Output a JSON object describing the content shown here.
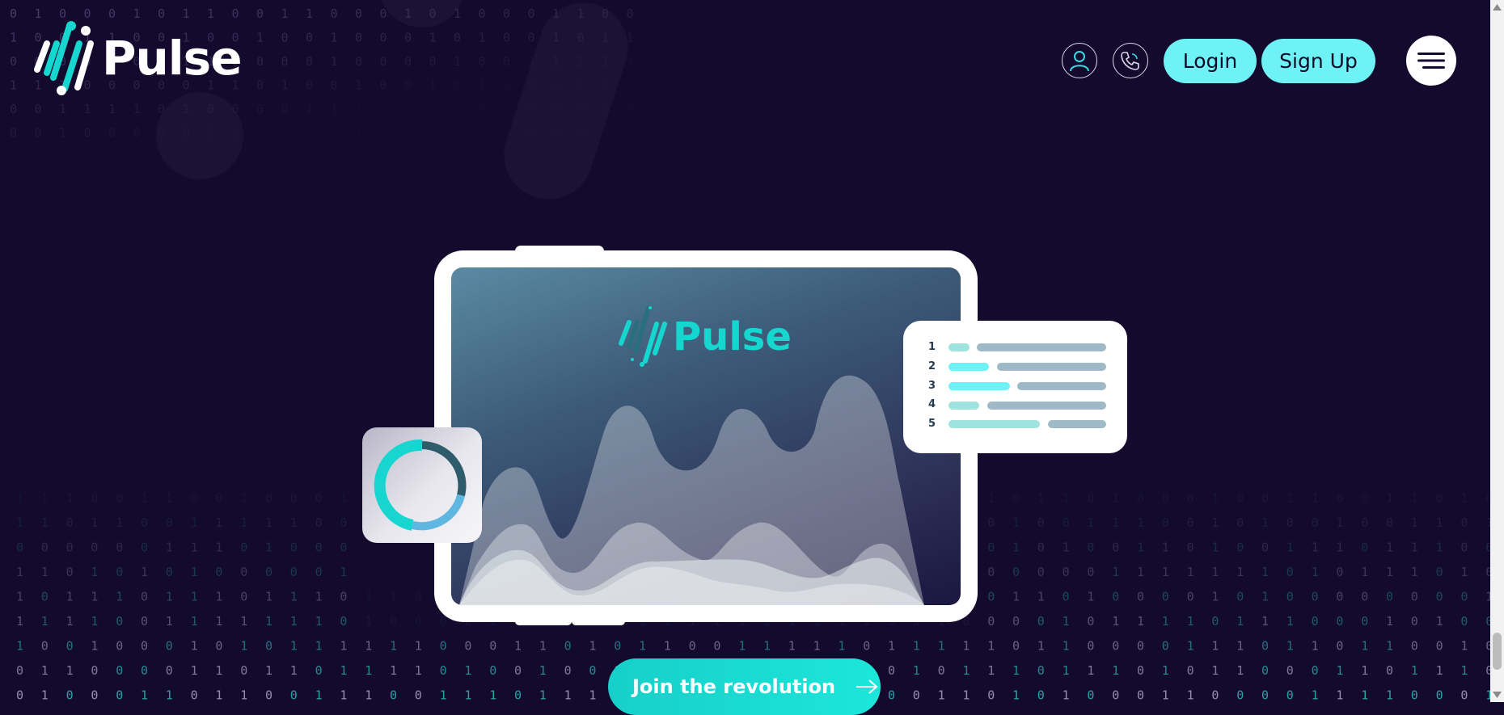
{
  "brand": {
    "name": "Pulse"
  },
  "header": {
    "login_label": "Login",
    "signup_label": "Sign Up",
    "account_icon": "user-icon",
    "contact_icon": "phone-icon",
    "menu_icon": "hamburger-icon"
  },
  "hero": {
    "screen_logo_text": "Pulse",
    "ranking_list": [
      {
        "rank": "1"
      },
      {
        "rank": "2"
      },
      {
        "rank": "3"
      },
      {
        "rank": "4"
      },
      {
        "rank": "5"
      }
    ],
    "cta_label": "Join the revolution",
    "cta_icon": "arrow-right-icon"
  },
  "colors": {
    "background": "#140a2e",
    "accent": "#6ef2f6",
    "teal": "#16d6d0"
  }
}
